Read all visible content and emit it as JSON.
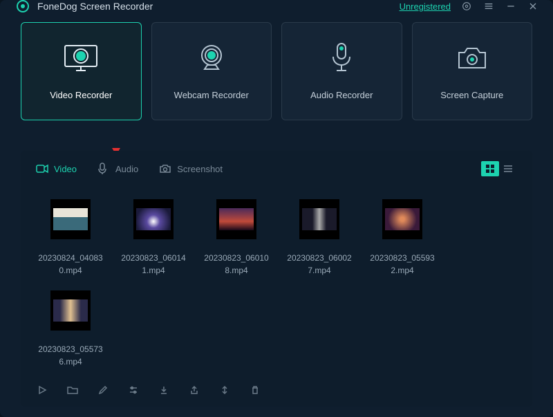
{
  "app": {
    "title": "FoneDog Screen Recorder",
    "status": "Unregistered"
  },
  "modes": [
    {
      "id": "video-recorder",
      "label": "Video Recorder",
      "selected": true
    },
    {
      "id": "webcam-recorder",
      "label": "Webcam Recorder",
      "selected": false
    },
    {
      "id": "audio-recorder",
      "label": "Audio Recorder",
      "selected": false
    },
    {
      "id": "screen-capture",
      "label": "Screen Capture",
      "selected": false
    }
  ],
  "library": {
    "tabs": [
      {
        "id": "video",
        "label": "Video",
        "active": true
      },
      {
        "id": "audio",
        "label": "Audio",
        "active": false
      },
      {
        "id": "screenshot",
        "label": "Screenshot",
        "active": false
      }
    ],
    "view": "grid",
    "items": [
      {
        "name": "20230824_040830.mp4"
      },
      {
        "name": "20230823_060141.mp4"
      },
      {
        "name": "20230823_060108.mp4"
      },
      {
        "name": "20230823_060027.mp4"
      },
      {
        "name": "20230823_055932.mp4"
      },
      {
        "name": "20230823_055736.mp4"
      }
    ]
  },
  "toolbar_icons": [
    "play",
    "folder",
    "edit",
    "settings",
    "import",
    "export",
    "link",
    "delete"
  ]
}
